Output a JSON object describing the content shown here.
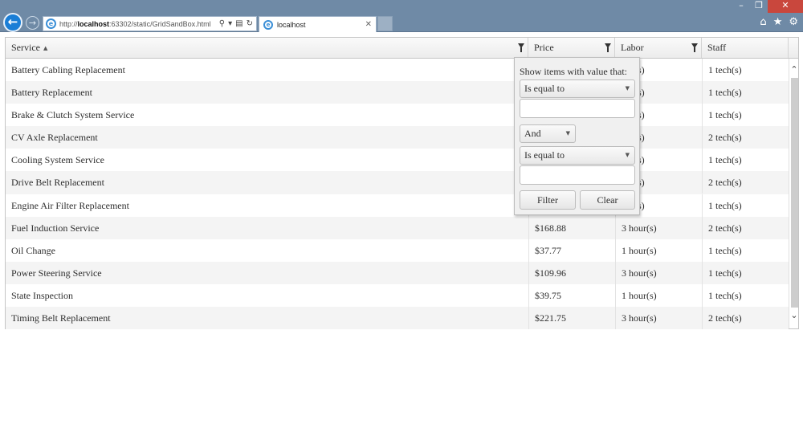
{
  "browser": {
    "url_prefix": "http://",
    "url_host": "localhost",
    "url_rest": ":63302/static/GridSandBox.html",
    "tab_title": "localhost",
    "icons": {
      "back": "arrow-left-icon",
      "forward": "arrow-right-icon",
      "search": "search-icon",
      "refresh": "refresh-icon",
      "home": "home-icon",
      "favorites": "star-icon",
      "settings": "gear-icon"
    }
  },
  "grid": {
    "columns": [
      {
        "label": "Service",
        "sorted": "asc",
        "filterable": true
      },
      {
        "label": "Price",
        "filterable": true
      },
      {
        "label": "Labor",
        "filterable": true
      },
      {
        "label": "Staff",
        "filterable": false
      }
    ],
    "rows": [
      {
        "service": "Battery Cabling Replacement",
        "price": "",
        "labor": "our(s)",
        "staff": "1 tech(s)"
      },
      {
        "service": "Battery Replacement",
        "price": "",
        "labor": "our(s)",
        "staff": "1 tech(s)"
      },
      {
        "service": "Brake & Clutch System Service",
        "price": "",
        "labor": "our(s)",
        "staff": "1 tech(s)"
      },
      {
        "service": "CV Axle Replacement",
        "price": "",
        "labor": "our(s)",
        "staff": "2 tech(s)"
      },
      {
        "service": "Cooling System Service",
        "price": "",
        "labor": "our(s)",
        "staff": "1 tech(s)"
      },
      {
        "service": "Drive Belt Replacement",
        "price": "",
        "labor": "our(s)",
        "staff": "2 tech(s)"
      },
      {
        "service": "Engine Air Filter Replacement",
        "price": "",
        "labor": "our(s)",
        "staff": "1 tech(s)"
      },
      {
        "service": "Fuel Induction Service",
        "price": "$168.88",
        "labor": "3 hour(s)",
        "staff": "2 tech(s)"
      },
      {
        "service": "Oil Change",
        "price": "$37.77",
        "labor": "1 hour(s)",
        "staff": "1 tech(s)"
      },
      {
        "service": "Power Steering Service",
        "price": "$109.96",
        "labor": "3 hour(s)",
        "staff": "1 tech(s)"
      },
      {
        "service": "State Inspection",
        "price": "$39.75",
        "labor": "1 hour(s)",
        "staff": "1 tech(s)"
      },
      {
        "service": "Timing Belt Replacement",
        "price": "$221.75",
        "labor": "3 hour(s)",
        "staff": "2 tech(s)"
      }
    ]
  },
  "filter_menu": {
    "help_text": "Show items with value that:",
    "operator1": "Is equal to",
    "value1": "",
    "logic": "And",
    "operator2": "Is equal to",
    "value2": "",
    "filter_label": "Filter",
    "clear_label": "Clear"
  },
  "colors": {
    "chrome": "#6f8aa6",
    "close_button": "#c9473d",
    "back_button": "#1a7ed6",
    "row_alt": "#f4f4f4"
  }
}
